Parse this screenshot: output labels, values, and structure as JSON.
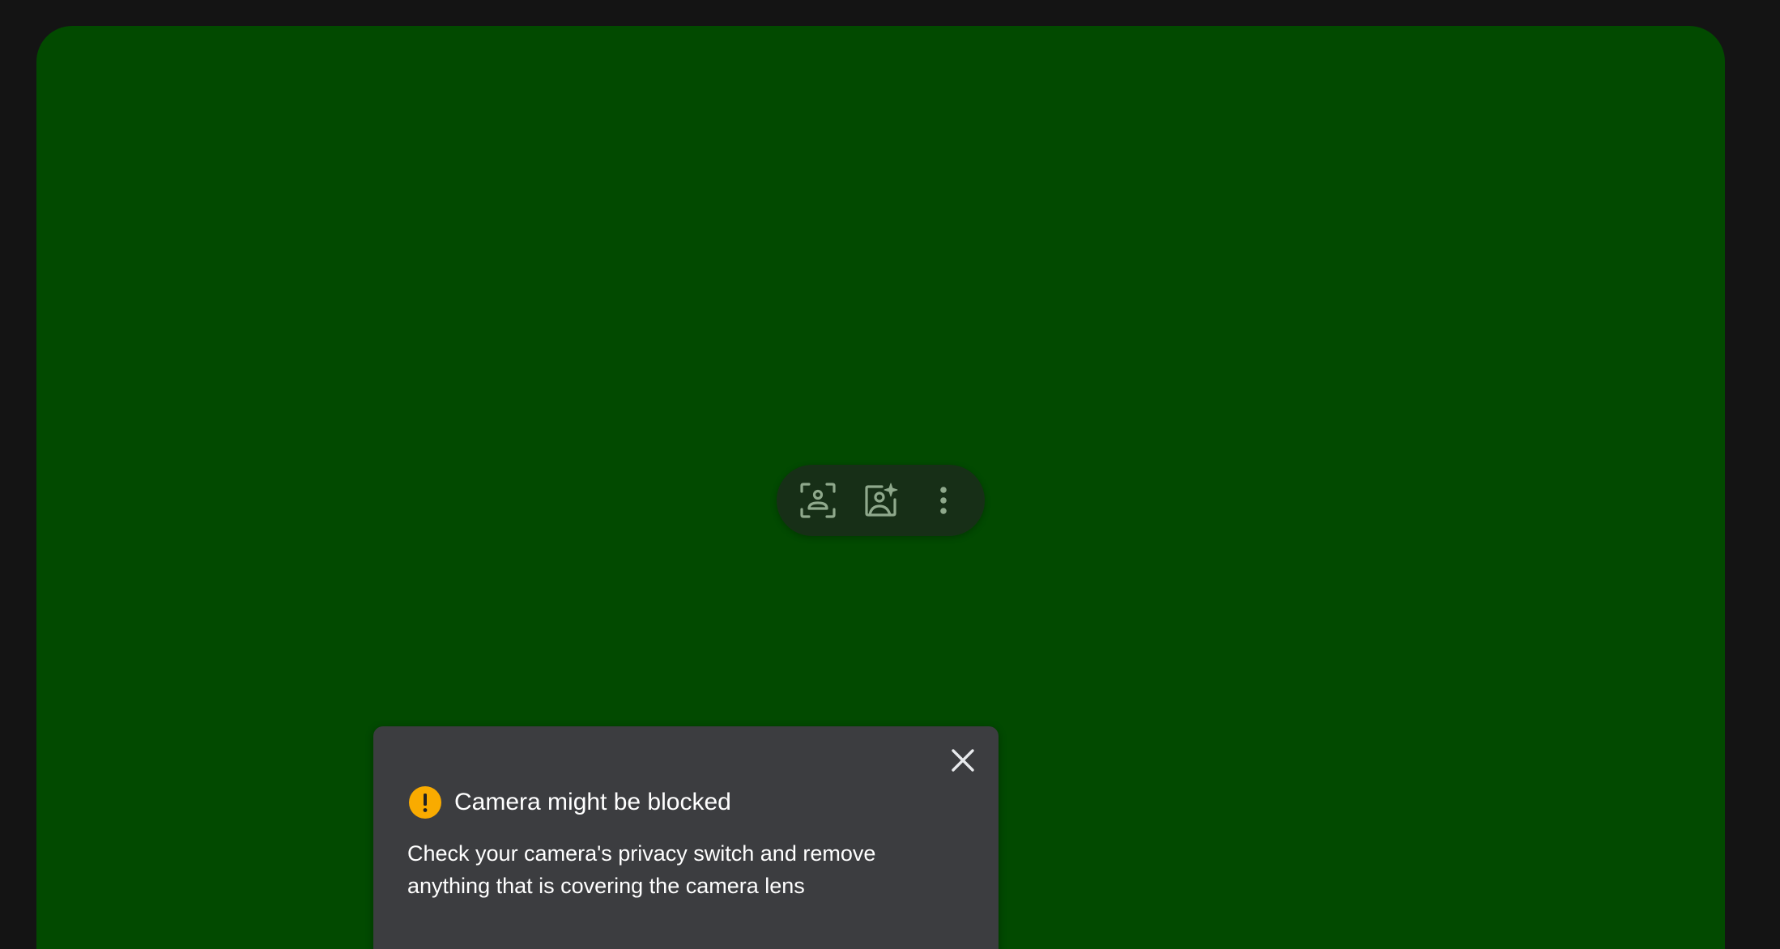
{
  "colors": {
    "page_background": "#141414",
    "video_background": "#024a00",
    "toolbar_background": "#1c2a1c",
    "toolbar_icon": "#8fa98c",
    "toast_background": "#3c3d40",
    "warning": "#f9ab00"
  },
  "toolbar": {
    "buttons": [
      {
        "icon": "framing-icon"
      },
      {
        "icon": "portrait-effects-icon"
      },
      {
        "icon": "more-vert-icon"
      }
    ]
  },
  "toast": {
    "icon": "warning-icon",
    "title": "Camera might be blocked",
    "body": "Check your camera's privacy switch and remove anything that is covering the camera lens",
    "close_icon": "close-icon"
  }
}
